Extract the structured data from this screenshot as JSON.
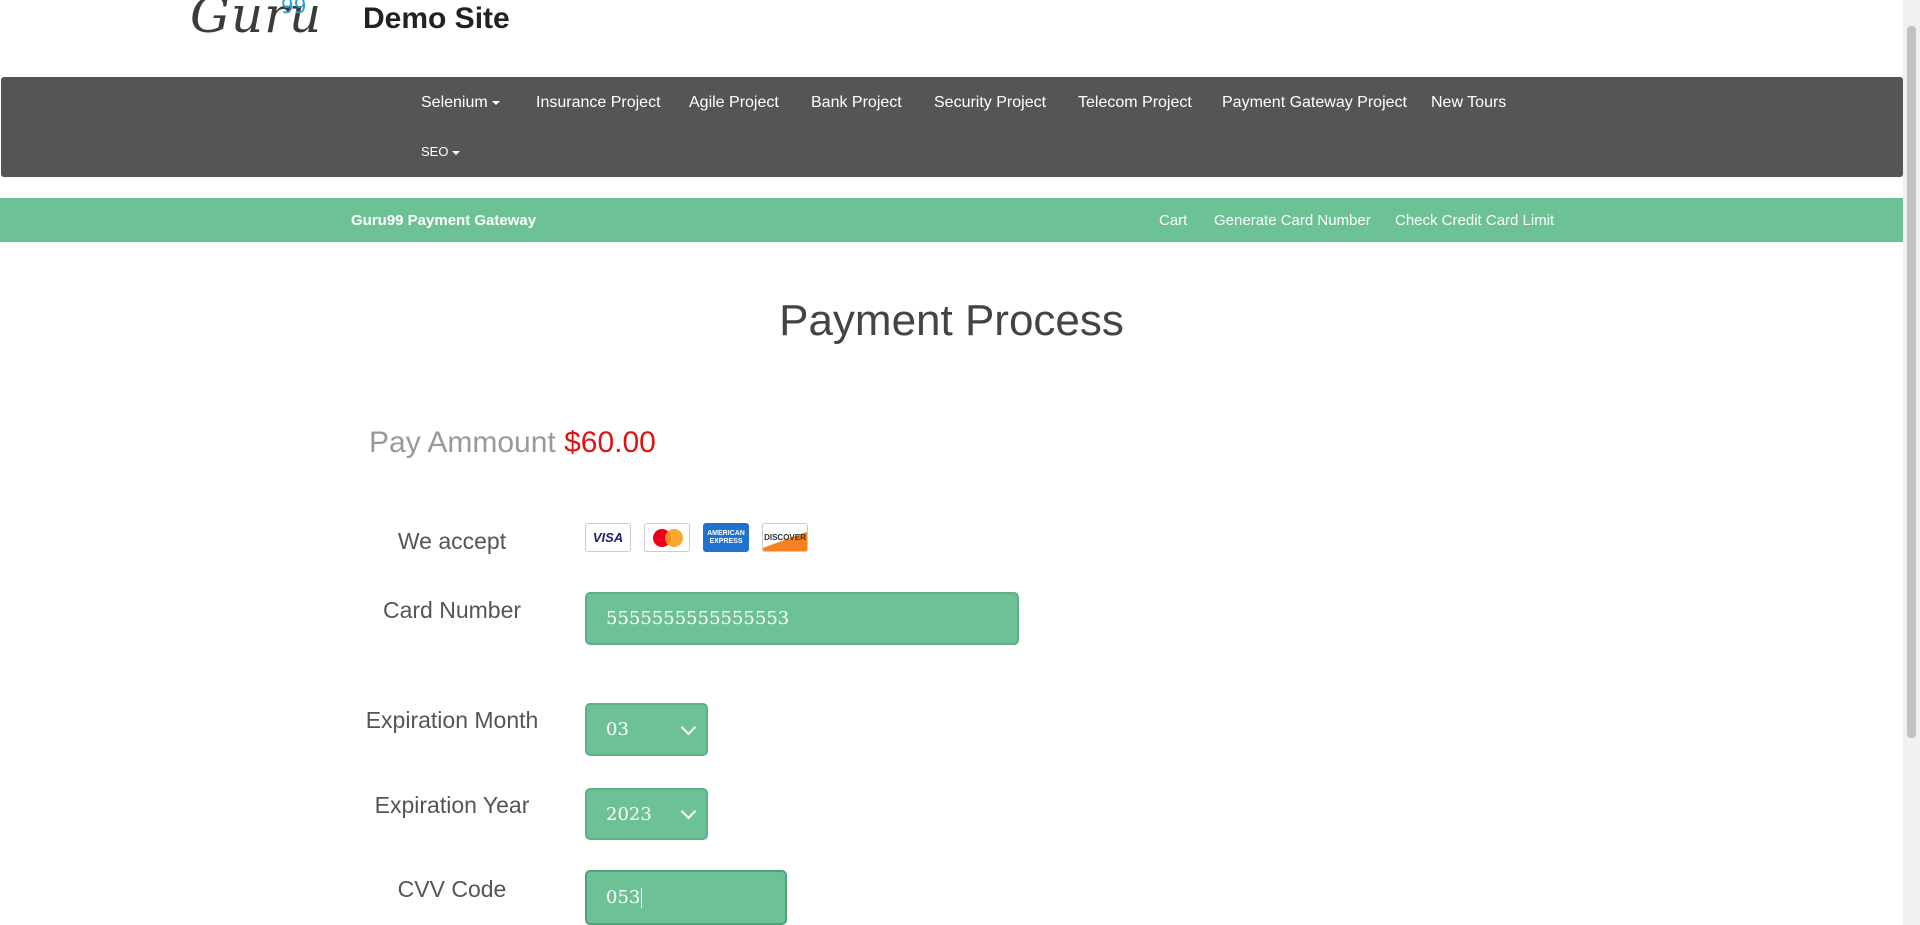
{
  "header": {
    "logo_text": "Guru",
    "logo_sup": "99",
    "site_title": "Demo Site"
  },
  "main_nav": {
    "items": [
      {
        "label": "Selenium",
        "dropdown": true
      },
      {
        "label": "Insurance Project"
      },
      {
        "label": "Agile Project"
      },
      {
        "label": "Bank Project"
      },
      {
        "label": "Security Project"
      },
      {
        "label": "Telecom Project"
      },
      {
        "label": "Payment Gateway Project"
      },
      {
        "label": "New Tours"
      },
      {
        "label": "SEO",
        "dropdown": true
      }
    ]
  },
  "sub_nav": {
    "brand": "Guru99 Payment Gateway",
    "links": [
      "Cart",
      "Generate Card Number",
      "Check Credit Card Limit"
    ]
  },
  "page": {
    "title": "Payment Process",
    "pay_label": "Pay Ammount",
    "pay_value": "$60.00"
  },
  "form": {
    "accept_label": "We accept",
    "cards": [
      "VISA",
      "MasterCard",
      "AMERICAN EXPRESS",
      "DISCOVER"
    ],
    "card_number_label": "Card Number",
    "card_number_value": "5555555555555553",
    "exp_month_label": "Expiration Month",
    "exp_month_value": "03",
    "exp_year_label": "Expiration Year",
    "exp_year_value": "2023",
    "cvv_label": "CVV Code",
    "cvv_value": "053"
  },
  "colors": {
    "nav_bg": "#555555",
    "accent_green": "#6cc195",
    "amount_red": "#e01313"
  }
}
